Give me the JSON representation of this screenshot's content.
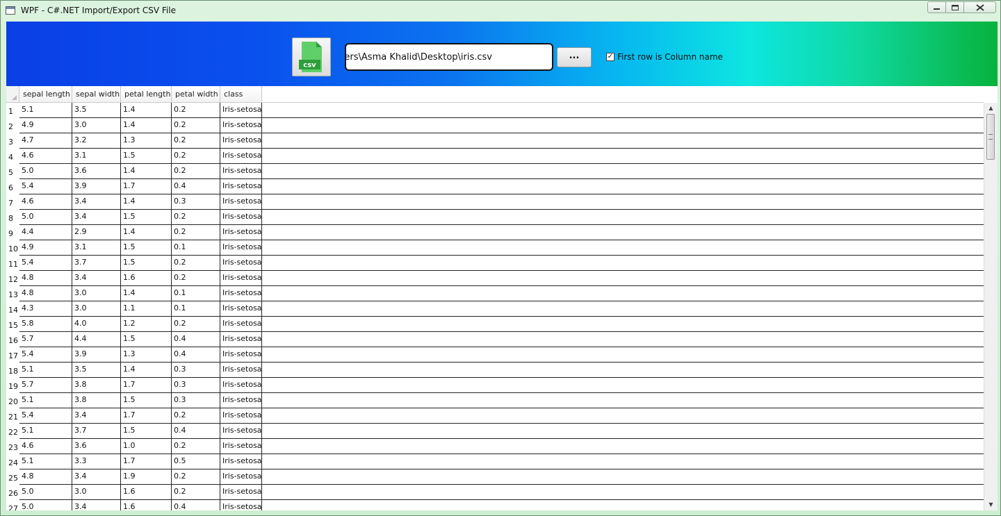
{
  "window": {
    "title": "WPF - C#.NET Import/Export CSV File",
    "controls": {
      "minimize": "minimize-icon",
      "maximize": "maximize-icon",
      "close": "close-icon"
    }
  },
  "toolbar": {
    "csv_icon_label": "csv",
    "path_value": "ers\\Asma Khalid\\Desktop\\iris.csv",
    "browse_label": "...",
    "first_row_checked": true,
    "first_row_label": "First row is Column name"
  },
  "colors": {
    "header_gradient_start": "#0a3fe6",
    "header_gradient_end": "#08b23c",
    "csv_green": "#2e9e3a"
  },
  "grid": {
    "columns": [
      "sepal length",
      "sepal width",
      "petal length",
      "petal width",
      "class"
    ],
    "rows": [
      [
        "1",
        "5.1",
        "3.5",
        "1.4",
        "0.2",
        "Iris-setosa"
      ],
      [
        "2",
        "4.9",
        "3.0",
        "1.4",
        "0.2",
        "Iris-setosa"
      ],
      [
        "3",
        "4.7",
        "3.2",
        "1.3",
        "0.2",
        "Iris-setosa"
      ],
      [
        "4",
        "4.6",
        "3.1",
        "1.5",
        "0.2",
        "Iris-setosa"
      ],
      [
        "5",
        "5.0",
        "3.6",
        "1.4",
        "0.2",
        "Iris-setosa"
      ],
      [
        "6",
        "5.4",
        "3.9",
        "1.7",
        "0.4",
        "Iris-setosa"
      ],
      [
        "7",
        "4.6",
        "3.4",
        "1.4",
        "0.3",
        "Iris-setosa"
      ],
      [
        "8",
        "5.0",
        "3.4",
        "1.5",
        "0.2",
        "Iris-setosa"
      ],
      [
        "9",
        "4.4",
        "2.9",
        "1.4",
        "0.2",
        "Iris-setosa"
      ],
      [
        "10",
        "4.9",
        "3.1",
        "1.5",
        "0.1",
        "Iris-setosa"
      ],
      [
        "11",
        "5.4",
        "3.7",
        "1.5",
        "0.2",
        "Iris-setosa"
      ],
      [
        "12",
        "4.8",
        "3.4",
        "1.6",
        "0.2",
        "Iris-setosa"
      ],
      [
        "13",
        "4.8",
        "3.0",
        "1.4",
        "0.1",
        "Iris-setosa"
      ],
      [
        "14",
        "4.3",
        "3.0",
        "1.1",
        "0.1",
        "Iris-setosa"
      ],
      [
        "15",
        "5.8",
        "4.0",
        "1.2",
        "0.2",
        "Iris-setosa"
      ],
      [
        "16",
        "5.7",
        "4.4",
        "1.5",
        "0.4",
        "Iris-setosa"
      ],
      [
        "17",
        "5.4",
        "3.9",
        "1.3",
        "0.4",
        "Iris-setosa"
      ],
      [
        "18",
        "5.1",
        "3.5",
        "1.4",
        "0.3",
        "Iris-setosa"
      ],
      [
        "19",
        "5.7",
        "3.8",
        "1.7",
        "0.3",
        "Iris-setosa"
      ],
      [
        "20",
        "5.1",
        "3.8",
        "1.5",
        "0.3",
        "Iris-setosa"
      ],
      [
        "21",
        "5.4",
        "3.4",
        "1.7",
        "0.2",
        "Iris-setosa"
      ],
      [
        "22",
        "5.1",
        "3.7",
        "1.5",
        "0.4",
        "Iris-setosa"
      ],
      [
        "23",
        "4.6",
        "3.6",
        "1.0",
        "0.2",
        "Iris-setosa"
      ],
      [
        "24",
        "5.1",
        "3.3",
        "1.7",
        "0.5",
        "Iris-setosa"
      ],
      [
        "25",
        "4.8",
        "3.4",
        "1.9",
        "0.2",
        "Iris-setosa"
      ],
      [
        "26",
        "5.0",
        "3.0",
        "1.6",
        "0.2",
        "Iris-setosa"
      ],
      [
        "27",
        "5.0",
        "3.4",
        "1.6",
        "0.4",
        "Iris-setosa"
      ]
    ]
  }
}
